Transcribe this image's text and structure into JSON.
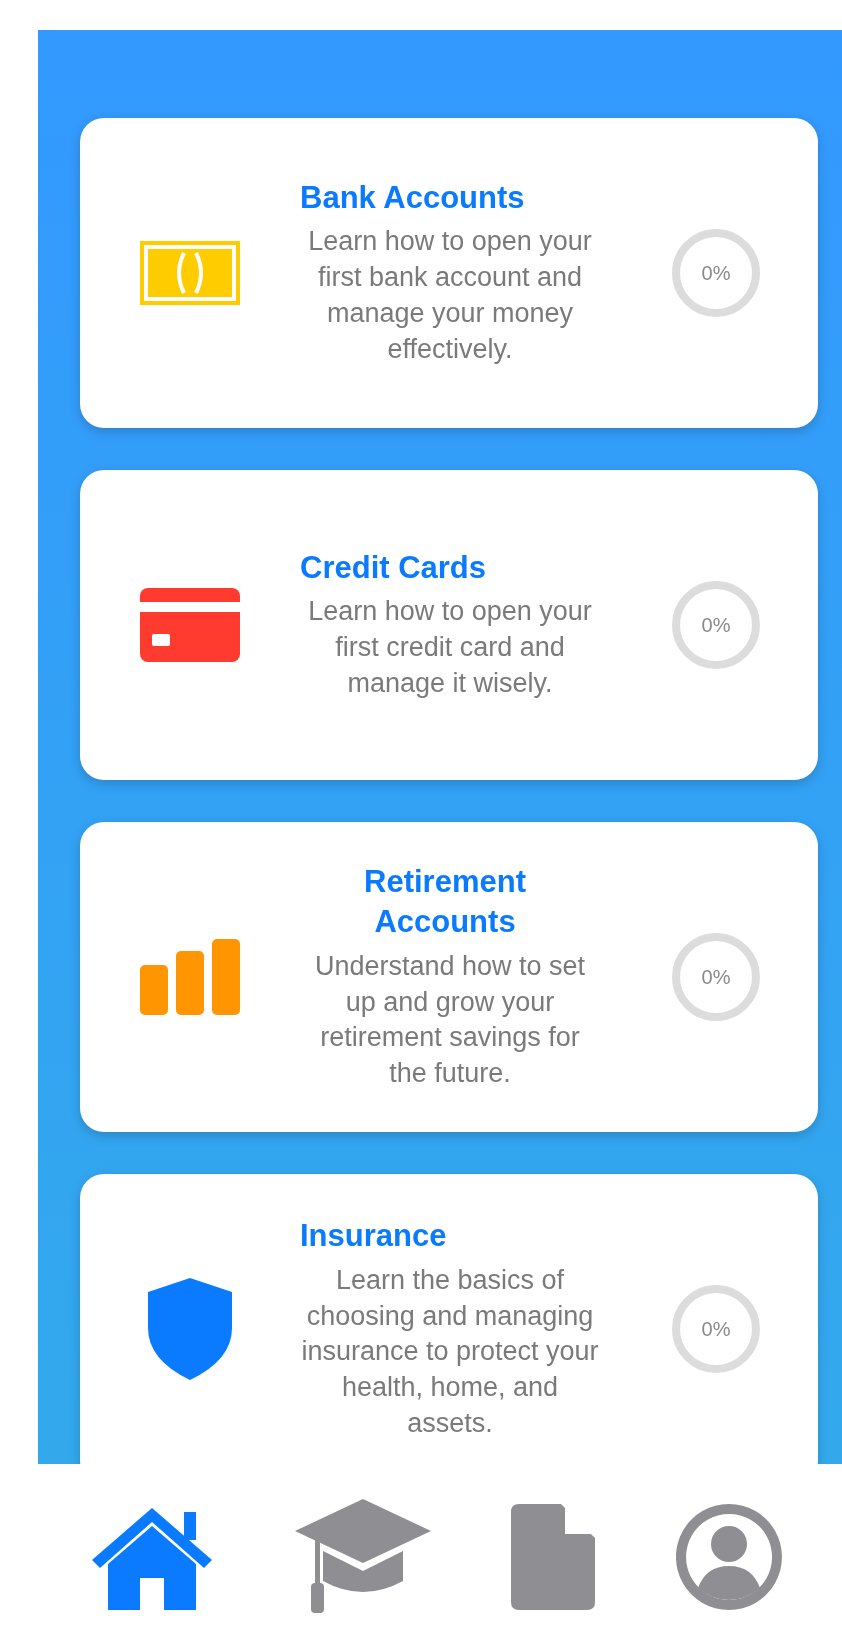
{
  "topics": [
    {
      "kind": "cash",
      "title": "Bank Accounts",
      "description": "Learn how to open your first bank account and manage your money effectively.",
      "progress": "0%"
    },
    {
      "kind": "card",
      "title": "Credit Cards",
      "description": "Learn how to open your first credit card and manage it wisely.",
      "progress": "0%"
    },
    {
      "kind": "chart",
      "title": "Retirement Accounts",
      "description": "Understand how to set up and grow your retirement savings for the future.",
      "progress": "0%"
    },
    {
      "kind": "shield",
      "title": "Insurance",
      "description": "Learn the basics of choosing and managing insurance to protect your health, home, and assets.",
      "progress": "0%"
    }
  ],
  "tabs": [
    {
      "kind": "home",
      "selected": true
    },
    {
      "kind": "learn",
      "selected": false
    },
    {
      "kind": "document",
      "selected": false
    },
    {
      "kind": "profile",
      "selected": false
    }
  ]
}
